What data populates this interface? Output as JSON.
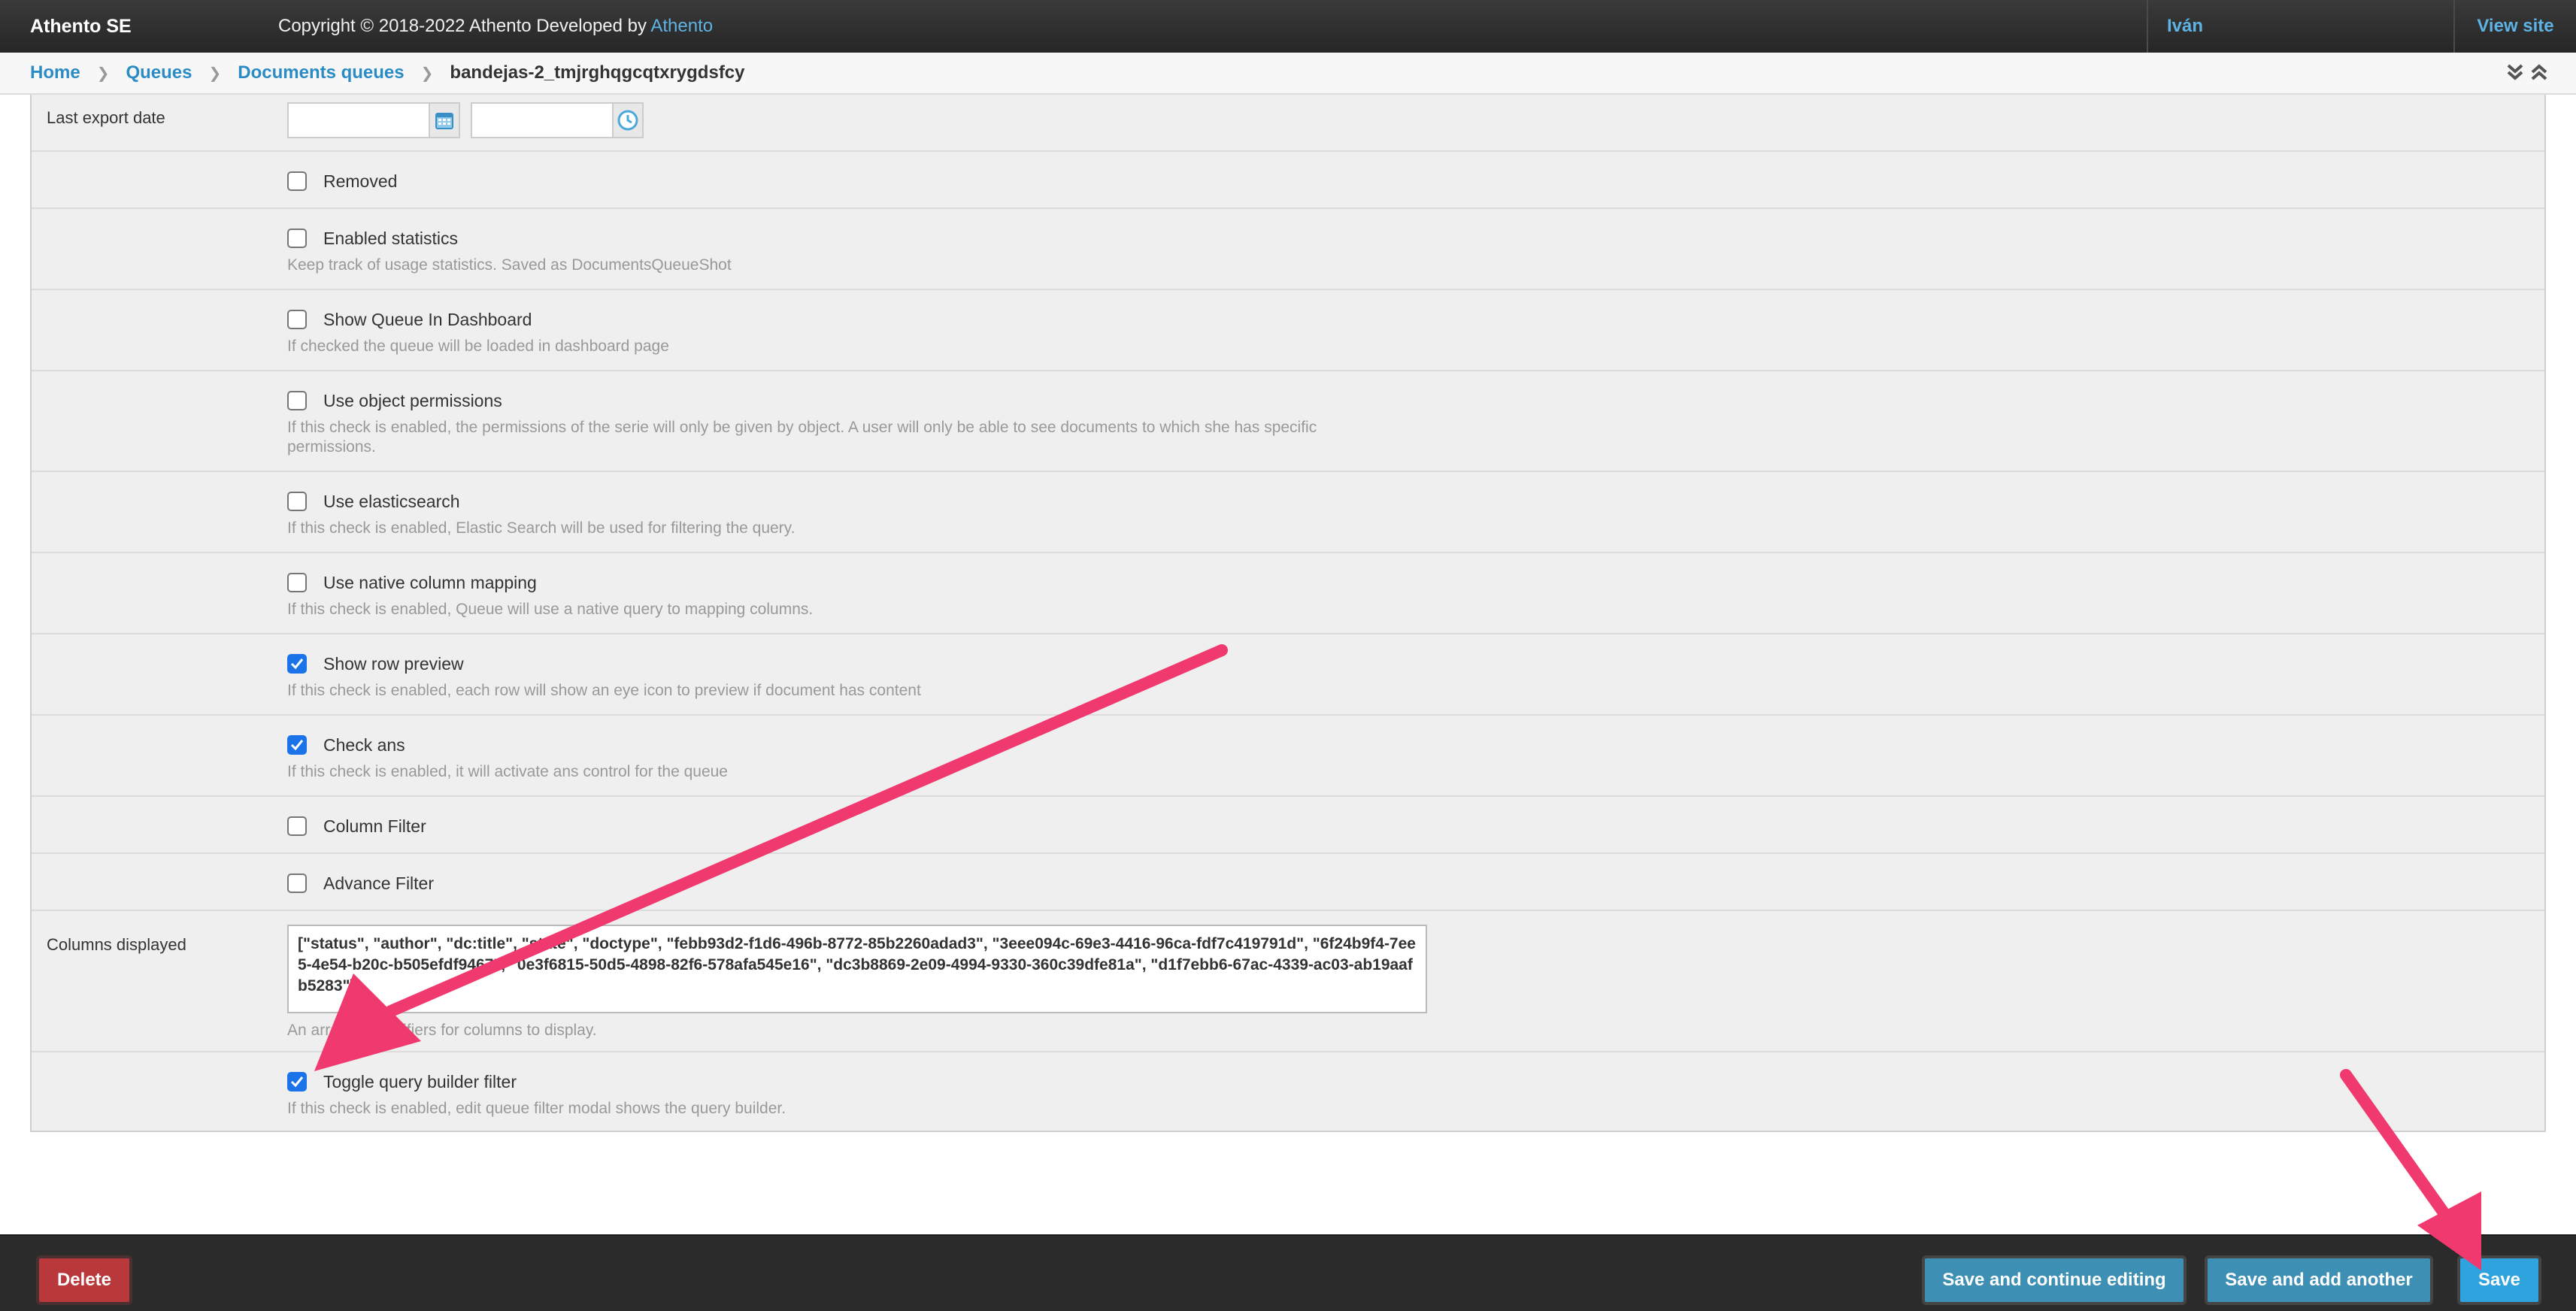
{
  "header": {
    "brand": "Athento SE",
    "copyright_text": "Copyright © 2018-2022 Athento Developed by ",
    "copyright_link": "Athento",
    "user": "Iván",
    "view_site": "View site"
  },
  "breadcrumbs": {
    "items": [
      "Home",
      "Queues",
      "Documents queues"
    ],
    "current": "bandejas-2_tmjrghqgcqtxrygdsfcy"
  },
  "form": {
    "last_export": {
      "label": "Last export date"
    },
    "removed": {
      "label": "Removed",
      "checked": false
    },
    "enabled_statistics": {
      "label": "Enabled statistics",
      "checked": false,
      "help": "Keep track of usage statistics. Saved as DocumentsQueueShot"
    },
    "show_in_dashboard": {
      "label": "Show Queue In Dashboard",
      "checked": false,
      "help": "If checked the queue will be loaded in dashboard page"
    },
    "object_permissions": {
      "label": "Use object permissions",
      "checked": false,
      "help": "If this check is enabled, the permissions of the serie will only be given by object. A user will only be able to see documents to which she has specific permissions."
    },
    "elasticsearch": {
      "label": "Use elasticsearch",
      "checked": false,
      "help": "If this check is enabled, Elastic Search will be used for filtering the query."
    },
    "native_mapping": {
      "label": "Use native column mapping",
      "checked": false,
      "help": "If this check is enabled, Queue will use a native query to mapping columns."
    },
    "row_preview": {
      "label": "Show row preview",
      "checked": true,
      "help": "If this check is enabled, each row will show an eye icon to preview if document has content"
    },
    "check_ans": {
      "label": "Check ans",
      "checked": true,
      "help": "If this check is enabled, it will activate ans control for the queue"
    },
    "column_filter": {
      "label": "Column Filter",
      "checked": false
    },
    "advance_filter": {
      "label": "Advance Filter",
      "checked": false
    },
    "columns_displayed": {
      "label": "Columns displayed",
      "value": "[\"status\", \"author\", \"dc:title\", \"state\", \"doctype\", \"febb93d2-f1d6-496b-8772-85b2260adad3\", \"3eee094c-69e3-4416-96ca-fdf7c419791d\", \"6f24b9f4-7ee5-4e54-b20c-b505efdf9467\", \"0e3f6815-50d5-4898-82f6-578afa545e16\", \"dc3b8869-2e09-4994-9330-360c39dfe81a\", \"d1f7ebb6-67ac-4339-ac03-ab19aafb5283\"]",
      "help": "An array of identifiers for columns to display."
    },
    "query_builder": {
      "label": "Toggle query builder filter",
      "checked": true,
      "help": "If this check is enabled, edit queue filter modal shows the query builder."
    }
  },
  "submit": {
    "delete": "Delete",
    "save_continue": "Save and continue editing",
    "save_another": "Save and add another",
    "save": "Save"
  },
  "colors": {
    "accent": "#2b8bc5",
    "annotation_arrow": "#f0396e",
    "delete": "#b8383c"
  }
}
